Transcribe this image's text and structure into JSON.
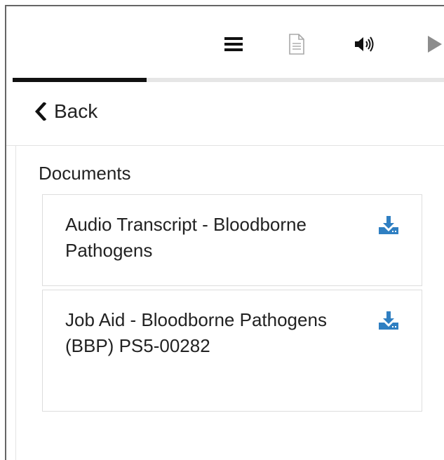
{
  "toolbar": {
    "menu_icon": "hamburger-menu-icon",
    "document_icon": "document-icon",
    "audio_icon": "speaker-volume-icon",
    "play_icon": "play-icon"
  },
  "progress": {
    "fraction": 0.31,
    "fill_color": "#111111",
    "track_color": "#e6e6e6"
  },
  "back": {
    "label": "Back",
    "icon": "chevron-left-icon"
  },
  "documents": {
    "title": "Documents",
    "items": [
      {
        "title": "Audio Transcript - Bloodborne Pathogens",
        "icon": "download-icon"
      },
      {
        "title": "Job Aid - Bloodborne Pathogens (BBP) PS5-00282",
        "icon": "download-icon"
      }
    ]
  },
  "colors": {
    "accent": "#2f7fc2",
    "text": "#222222",
    "icon_gray": "#b3b3b3"
  }
}
